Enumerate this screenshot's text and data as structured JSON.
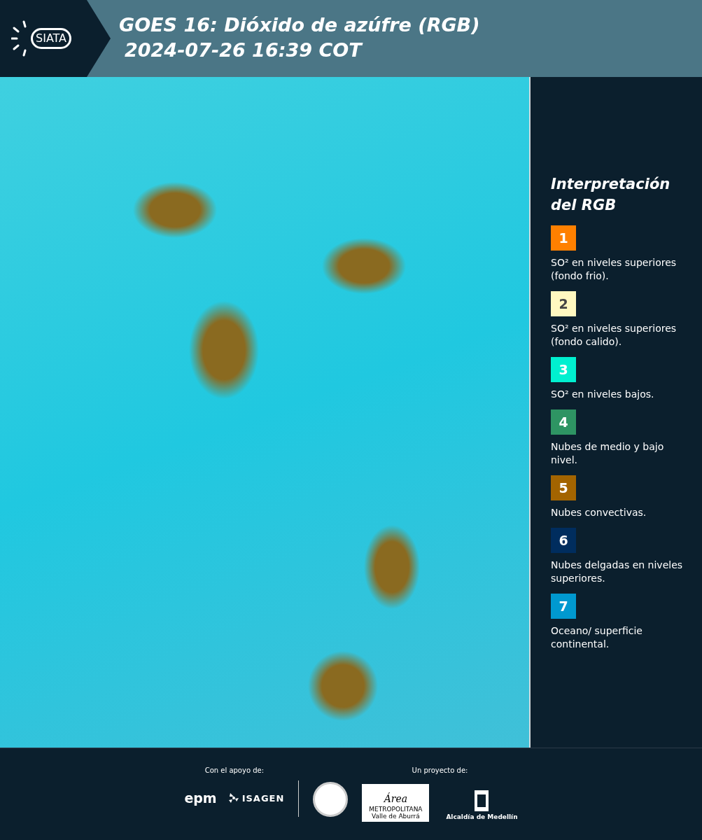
{
  "header": {
    "logo": "SIATA",
    "title": "GOES 16: Dióxido de azúfre (RGB)",
    "timestamp": "2024-07-26 16:39 COT"
  },
  "legend": {
    "title": "Interpretación del RGB",
    "items": [
      {
        "number": "1",
        "color": "#ff8000",
        "text": "SO² en niveles superiores (fondo frio)."
      },
      {
        "number": "2",
        "color": "#fff8c0",
        "text": "SO² en niveles superiores (fondo calido)."
      },
      {
        "number": "3",
        "color": "#00f0d0",
        "text": "SO² en niveles bajos."
      },
      {
        "number": "4",
        "color": "#2e9463",
        "text": "Nubes de medio y bajo nivel."
      },
      {
        "number": "5",
        "color": "#a36400",
        "text": "Nubes convectivas."
      },
      {
        "number": "6",
        "color": "#002d5e",
        "text": "Nubes delgadas en niveles superiores."
      },
      {
        "number": "7",
        "color": "#0099d0",
        "text": "Oceano/ superficie continental."
      }
    ]
  },
  "footer": {
    "support_label": "Con el apoyo de:",
    "supporters": [
      "epm",
      "ISAGEN"
    ],
    "project_label": "Un proyecto de:",
    "area_logo": {
      "title": "Área",
      "line1": "METROPOLITANA",
      "line2": "Valle de Aburrá"
    },
    "alcaldia": "Alcaldía de Medellín"
  }
}
